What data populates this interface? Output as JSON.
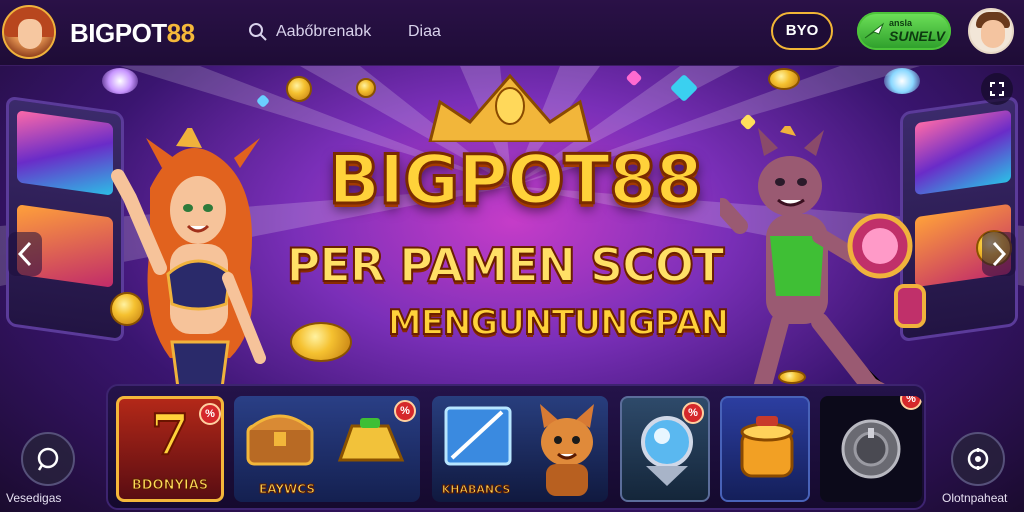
{
  "header": {
    "brand_part1": "BIGPOT",
    "brand_part2": "88",
    "search_label": "Aabőbrenabk",
    "nav_link": "Diaa",
    "pill_button": "BYO",
    "green_button_small": "ansla",
    "green_button_main": "SUNELV"
  },
  "hero": {
    "title": "BIGPOT88",
    "subtitle_line1": "PER PAMEN SCOT",
    "subtitle_line2": "MENGUNTUNGPAN"
  },
  "games": [
    {
      "label_top": "7",
      "label": "BDONYIAS",
      "badge": "%"
    },
    {
      "label": "EAYWCS",
      "badge": "%"
    },
    {
      "label": "KHABANCS",
      "badge": ""
    },
    {
      "label": "",
      "badge": "%"
    },
    {
      "label": "",
      "badge": ""
    },
    {
      "label": "",
      "badge": "%"
    }
  ],
  "side": {
    "left_label": "Vesedigas",
    "right_label": "Olotnpaheat"
  },
  "colors": {
    "accent_gold": "#f5b83a",
    "accent_green": "#3fbf35",
    "bg_purple": "#1e0c36",
    "badge_red": "#d5282b"
  },
  "icons": {
    "search": "search-icon",
    "arrow_left": "chevron-left-icon",
    "arrow_right": "chevron-right-icon",
    "expand": "expand-icon",
    "chat": "chat-icon",
    "support": "support-icon"
  }
}
